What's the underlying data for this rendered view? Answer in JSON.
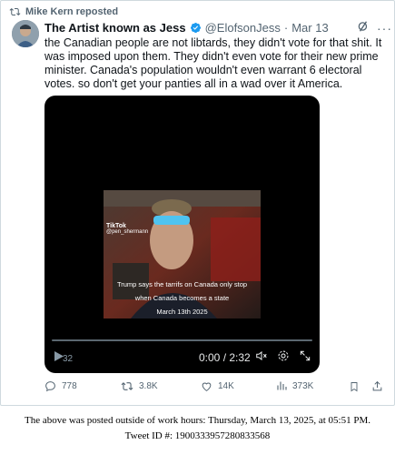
{
  "repost": {
    "label": "Mike Kern reposted",
    "icon": "repost-icon"
  },
  "post": {
    "author_name": "The Artist known as Jess",
    "verified_icon": "verified-badge-icon",
    "handle": "@ElofsonJess",
    "separator": "·",
    "date": "Mar 13",
    "text": "the Canadian people are not libtards, they didn't vote for that shit. It was imposed upon them. They didn't even vote for their new prime minister. Canada's population wouldn't even warrant 6 electoral votes. so don't get your panties all in a wad over it America."
  },
  "video": {
    "watermark_brand": "TikTok",
    "watermark_handle": "@pen_shermann",
    "caption_line1": "Trump says the tarrifs on Canada only stop",
    "caption_line2": "when Canada becomes a state",
    "caption_line3": "March 13th 2025",
    "current_time_label": "32",
    "time_display": "0:00 / 2:32",
    "progress_fraction": 0.0
  },
  "actions": {
    "replies": "778",
    "reposts": "3.8K",
    "likes": "14K",
    "views": "373K"
  },
  "footer": {
    "line1": "The above was posted outside of work hours: Thursday, March 13, 2025, at 05:51 PM.",
    "line2": "Tweet ID #: 1900333957280833568"
  },
  "colors": {
    "accent": "#1d9bf0",
    "muted": "#536471",
    "text": "#0f1419"
  }
}
